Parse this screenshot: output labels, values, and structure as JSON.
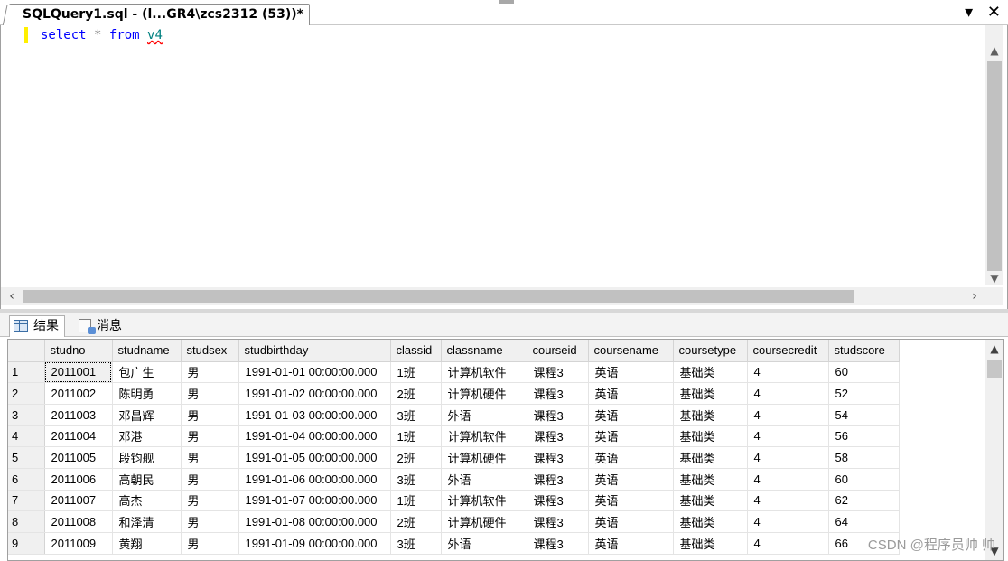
{
  "tab": {
    "title": "SQLQuery1.sql - (l...GR4\\zcs2312 (53))*",
    "dropdown_glyph": "▾",
    "close_glyph": "✕"
  },
  "editor": {
    "keyword_select": "select",
    "star": "*",
    "keyword_from": "from",
    "object": "v4"
  },
  "results_tabs": {
    "results_label": "结果",
    "messages_label": "消息"
  },
  "grid": {
    "columns": [
      "",
      "studno",
      "studname",
      "studsex",
      "studbirthday",
      "classid",
      "classname",
      "courseid",
      "coursename",
      "coursetype",
      "coursecredit",
      "studscore"
    ],
    "rows": [
      [
        "1",
        "2011001",
        "包广生",
        "男",
        "1991-01-01 00:00:00.000",
        "1班",
        "计算机软件",
        "课程3",
        "英语",
        "基础类",
        "4",
        "60"
      ],
      [
        "2",
        "2011002",
        "陈明勇",
        "男",
        "1991-01-02 00:00:00.000",
        "2班",
        "计算机硬件",
        "课程3",
        "英语",
        "基础类",
        "4",
        "52"
      ],
      [
        "3",
        "2011003",
        "邓昌辉",
        "男",
        "1991-01-03 00:00:00.000",
        "3班",
        "外语",
        "课程3",
        "英语",
        "基础类",
        "4",
        "54"
      ],
      [
        "4",
        "2011004",
        "邓港",
        "男",
        "1991-01-04 00:00:00.000",
        "1班",
        "计算机软件",
        "课程3",
        "英语",
        "基础类",
        "4",
        "56"
      ],
      [
        "5",
        "2011005",
        "段钧舰",
        "男",
        "1991-01-05 00:00:00.000",
        "2班",
        "计算机硬件",
        "课程3",
        "英语",
        "基础类",
        "4",
        "58"
      ],
      [
        "6",
        "2011006",
        "高朝民",
        "男",
        "1991-01-06 00:00:00.000",
        "3班",
        "外语",
        "课程3",
        "英语",
        "基础类",
        "4",
        "60"
      ],
      [
        "7",
        "2011007",
        "高杰",
        "男",
        "1991-01-07 00:00:00.000",
        "1班",
        "计算机软件",
        "课程3",
        "英语",
        "基础类",
        "4",
        "62"
      ],
      [
        "8",
        "2011008",
        "和泽清",
        "男",
        "1991-01-08 00:00:00.000",
        "2班",
        "计算机硬件",
        "课程3",
        "英语",
        "基础类",
        "4",
        "64"
      ],
      [
        "9",
        "2011009",
        "黄翔",
        "男",
        "1991-01-09 00:00:00.000",
        "3班",
        "外语",
        "课程3",
        "英语",
        "基础类",
        "4",
        "66"
      ]
    ]
  },
  "watermark": "CSDN @程序员帅 帅"
}
